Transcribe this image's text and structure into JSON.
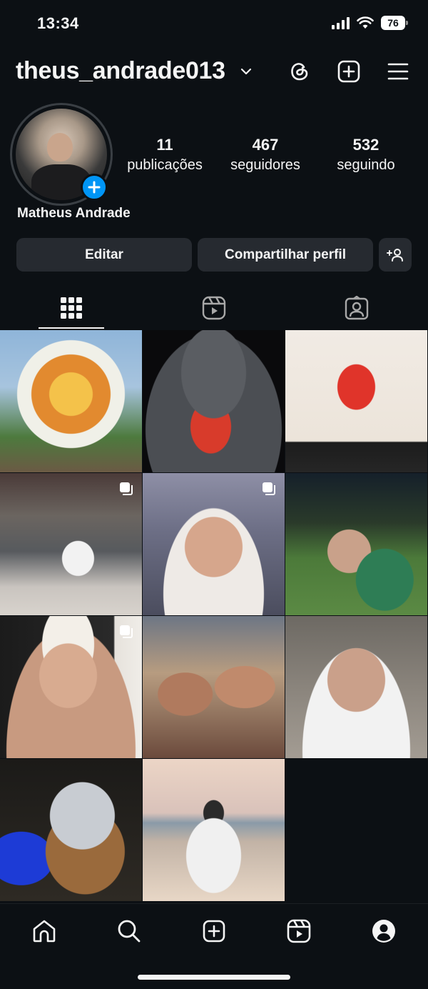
{
  "status": {
    "time": "13:34",
    "battery": "76"
  },
  "header": {
    "username": "theus_andrade013",
    "icons": [
      "chevron-down-icon",
      "threads-icon",
      "new-post-icon",
      "menu-icon"
    ]
  },
  "profile": {
    "display_name": "Matheus Andrade",
    "stats": [
      {
        "value": "11",
        "label": "publicações"
      },
      {
        "value": "467",
        "label": "seguidores"
      },
      {
        "value": "532",
        "label": "seguindo"
      }
    ]
  },
  "actions": {
    "edit_label": "Editar",
    "share_label": "Compartilhar perfil"
  },
  "tabs": [
    "grid-icon",
    "reels-icon",
    "tagged-icon"
  ],
  "posts_count": 11,
  "colors": {
    "background": "#0c1014",
    "button": "#262a30",
    "accent": "#0095f6",
    "text": "#f5f5f5"
  },
  "bottom_nav": [
    "home-icon",
    "search-icon",
    "create-icon",
    "reels-icon",
    "profile-icon"
  ]
}
